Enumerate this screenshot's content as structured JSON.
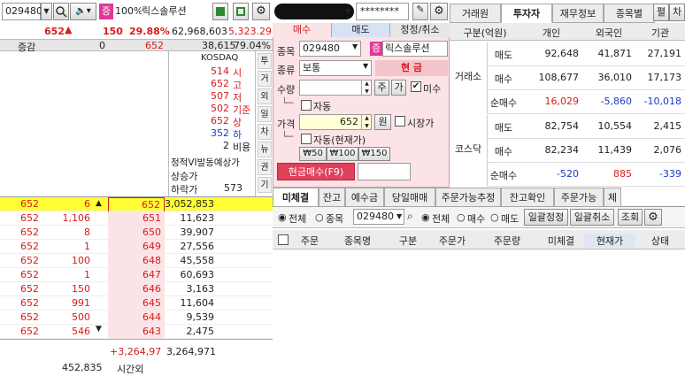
{
  "toolbar": {
    "code": "029480",
    "badge": "증",
    "pct": "100%",
    "name": "릭스솔루션",
    "password": "********",
    "btn_cha": "차",
    "btn_pyeol": "펼"
  },
  "quote": {
    "price": "652",
    "change": "150",
    "change_pct": "29.88%",
    "volume": "62,968,603",
    "vol_extra": "5,323.29",
    "diff_label": "증감",
    "diff_val": "0",
    "cur": "652",
    "total": "38,615",
    "ratio": "79.04%"
  },
  "info": {
    "market": "KOSDAQ",
    "items": [
      {
        "v": "514",
        "k": "시"
      },
      {
        "v": "652",
        "k": "고"
      },
      {
        "v": "507",
        "k": "저"
      },
      {
        "v": "502",
        "k": "기준"
      },
      {
        "v": "652",
        "k": "상"
      },
      {
        "v": "352",
        "k": "하"
      },
      {
        "v": "2",
        "k": "비용"
      }
    ],
    "vi": "정적VI발동예상가",
    "upper": "상승가",
    "lower": "하락가",
    "lower_val": "573"
  },
  "side_tabs": [
    "투",
    "거",
    "외",
    "일",
    "차",
    "뉴",
    "권",
    "기"
  ],
  "book": {
    "rows": [
      {
        "p": "652",
        "q": "6",
        "px": "652",
        "vol": "3,052,853",
        "hl": true
      },
      {
        "p": "652",
        "q": "1,106",
        "px": "651",
        "vol": "11,623"
      },
      {
        "p": "652",
        "q": "8",
        "px": "650",
        "vol": "39,907"
      },
      {
        "p": "652",
        "q": "1",
        "px": "649",
        "vol": "27,556"
      },
      {
        "p": "652",
        "q": "100",
        "px": "648",
        "vol": "45,558"
      },
      {
        "p": "652",
        "q": "1",
        "px": "647",
        "vol": "60,693"
      },
      {
        "p": "652",
        "q": "150",
        "px": "646",
        "vol": "3,163"
      },
      {
        "p": "652",
        "q": "991",
        "px": "645",
        "vol": "11,604"
      },
      {
        "p": "652",
        "q": "500",
        "px": "644",
        "vol": "9,539"
      },
      {
        "p": "652",
        "q": "546",
        "px": "643",
        "vol": "2,475"
      }
    ],
    "foot_a": "+3,264,97",
    "foot_b": "3,264,971",
    "foot_c": "452,835",
    "foot_d": "시간외"
  },
  "order": {
    "tabs": [
      "매수",
      "매도",
      "정정/취소"
    ],
    "code_label": "종목",
    "code": "029480",
    "badge": "증",
    "name": "릭스솔루션",
    "type_label": "종류",
    "type": "보통",
    "cash": "현 금",
    "qty_label": "수량",
    "qty_btn1": "주",
    "qty_btn2": "가",
    "unfilled": "미수",
    "auto1": "자동",
    "price_label": "가격",
    "price": "652",
    "unit": "원",
    "market_price": "시장가",
    "auto2": "자동(현재가)",
    "steps": [
      "₩50",
      "₩100",
      "₩150"
    ],
    "submit": "현금매수(F9)"
  },
  "investor": {
    "tabs": [
      "거래원",
      "투자자",
      "재무정보",
      "종목별"
    ],
    "headers": [
      "구분(억원)",
      "개인",
      "외국인",
      "기관"
    ],
    "groups": [
      {
        "name": "거래소",
        "rows": [
          {
            "k": "매도",
            "a": "92,648",
            "b": "41,871",
            "c": "27,191"
          },
          {
            "k": "매수",
            "a": "108,677",
            "b": "36,010",
            "c": "17,173"
          },
          {
            "k": "순매수",
            "a": "16,029",
            "b": "-5,860",
            "c": "-10,018"
          }
        ]
      },
      {
        "name": "코스닥",
        "rows": [
          {
            "k": "매도",
            "a": "82,754",
            "b": "10,554",
            "c": "2,415"
          },
          {
            "k": "매수",
            "a": "82,234",
            "b": "11,439",
            "c": "2,076"
          },
          {
            "k": "순매수",
            "a": "-520",
            "b": "885",
            "c": "-339"
          }
        ]
      }
    ]
  },
  "bottom": {
    "tabs": [
      "미체결",
      "잔고",
      "예수금",
      "당일매매",
      "주문가능추정",
      "잔고확인",
      "주문가능",
      "체"
    ],
    "radio1": [
      "전체",
      "종목"
    ],
    "code": "029480",
    "radio2": [
      "전체",
      "매수",
      "매도"
    ],
    "btn1": "일괄정정",
    "btn2": "일괄취소",
    "btn3": "조회",
    "cols": [
      "주문",
      "종목명",
      "구분",
      "주문가",
      "주문량",
      "미체결",
      "현재가",
      "상태"
    ]
  },
  "colors": {
    "red": "#d81b1b",
    "blue": "#1a3ccc",
    "hl": "#ffff33",
    "buy_bg": "#fbe3e6"
  }
}
